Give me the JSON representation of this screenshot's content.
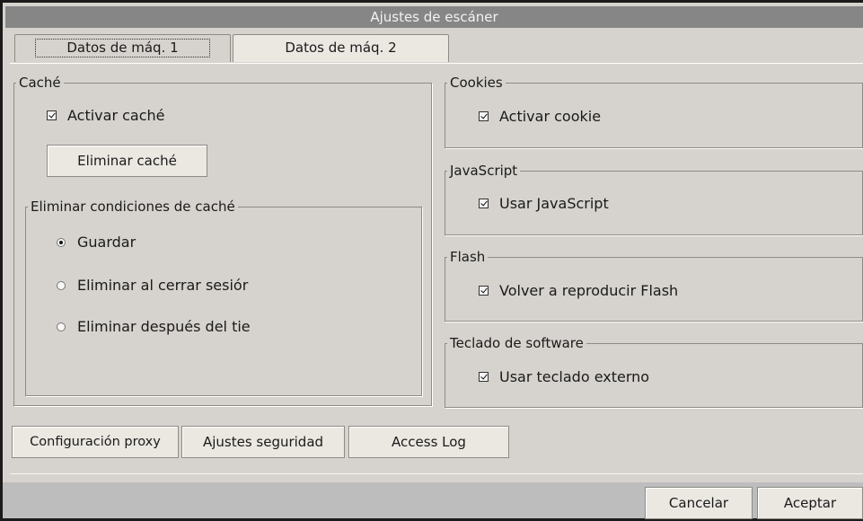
{
  "window": {
    "title": "Ajustes de escáner"
  },
  "tabs": [
    {
      "label": "Datos de máq. 1",
      "active": true
    },
    {
      "label": "Datos de máq. 2",
      "active": false
    }
  ],
  "cache": {
    "legend": "Caché",
    "enable_label": "Activar caché",
    "enable_checked": true,
    "delete_button": "Eliminar caché",
    "conditions": {
      "legend": "Eliminar condiciones de caché",
      "options": [
        {
          "label": "Guardar",
          "selected": true
        },
        {
          "label": "Eliminar al cerrar sesiór",
          "selected": false
        },
        {
          "label": "Eliminar después del tie",
          "selected": false
        }
      ]
    }
  },
  "cookies": {
    "legend": "Cookies",
    "label": "Activar cookie",
    "checked": true
  },
  "javascript": {
    "legend": "JavaScript",
    "label": "Usar JavaScript",
    "checked": true
  },
  "flash": {
    "legend": "Flash",
    "label": "Volver a reproducir Flash",
    "checked": true
  },
  "keyboard": {
    "legend": "Teclado de software",
    "label": "Usar teclado externo",
    "checked": true
  },
  "bottom_buttons": {
    "proxy": "Configuración proxy",
    "security": "Ajustes seguridad",
    "access_log": "Access Log"
  },
  "dialog_buttons": {
    "cancel": "Cancelar",
    "accept": "Aceptar"
  },
  "colors": {
    "title_bar": "#868686",
    "dialog_bg": "#d6d3ce",
    "button_bg": "#ebe8e2",
    "footer_bg": "#bdbdbd"
  }
}
